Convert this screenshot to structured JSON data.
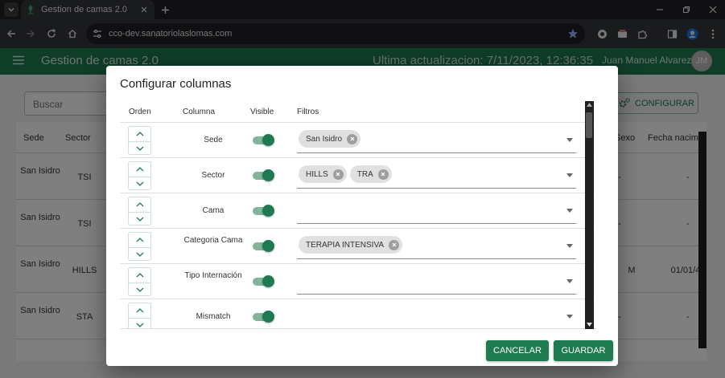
{
  "browser": {
    "tab_title": "Gestion de camas 2.0",
    "url": "cco-dev.sanatoriolaslomas.com"
  },
  "app": {
    "title": "Gestion de camas 2.0",
    "last_update": "Ultima actualizacion: 7/11/2023, 12:36:35",
    "user_name": "Juan Manuel Alvarez",
    "avatar_initials": "JM",
    "search_placeholder": "Buscar",
    "configure_label": "CONFIGURAR",
    "accent_color": "#1e7a51"
  },
  "background_table": {
    "headers": {
      "sede": "Sede",
      "sector": "Sector",
      "sexo": "Sexo",
      "fecha": "Fecha nacimi"
    },
    "rows": [
      {
        "sede": "San Isidro",
        "sector": "TSI",
        "sexo": "-",
        "fecha": "-"
      },
      {
        "sede": "San Isidro",
        "sector": "TSI",
        "sexo": "-",
        "fecha": "-"
      },
      {
        "sede": "San Isidro",
        "sector": "HILLS",
        "sexo": "M",
        "fecha": "01/01/4"
      },
      {
        "sede": "San Isidro",
        "sector": "STA",
        "sexo": "-",
        "fecha": "-"
      }
    ]
  },
  "dialog": {
    "title": "Configurar columnas",
    "headers": {
      "orden": "Orden",
      "columna": "Columna",
      "visible": "Visible",
      "filtros": "Filtros"
    },
    "rows": [
      {
        "column": "Sede",
        "visible": true,
        "filters": [
          "San Isidro"
        ]
      },
      {
        "column": "Sector",
        "visible": true,
        "filters": [
          "HILLS",
          "TRA"
        ]
      },
      {
        "column": "Cama",
        "visible": true,
        "filters": []
      },
      {
        "column": "Categoria Cama",
        "visible": true,
        "filters": [
          "TERAPIA INTENSIVA"
        ]
      },
      {
        "column": "Tipo Internación",
        "visible": true,
        "filters": []
      },
      {
        "column": "Mismatch",
        "visible": true,
        "filters": []
      }
    ],
    "cancel_label": "CANCELAR",
    "save_label": "GUARDAR"
  }
}
